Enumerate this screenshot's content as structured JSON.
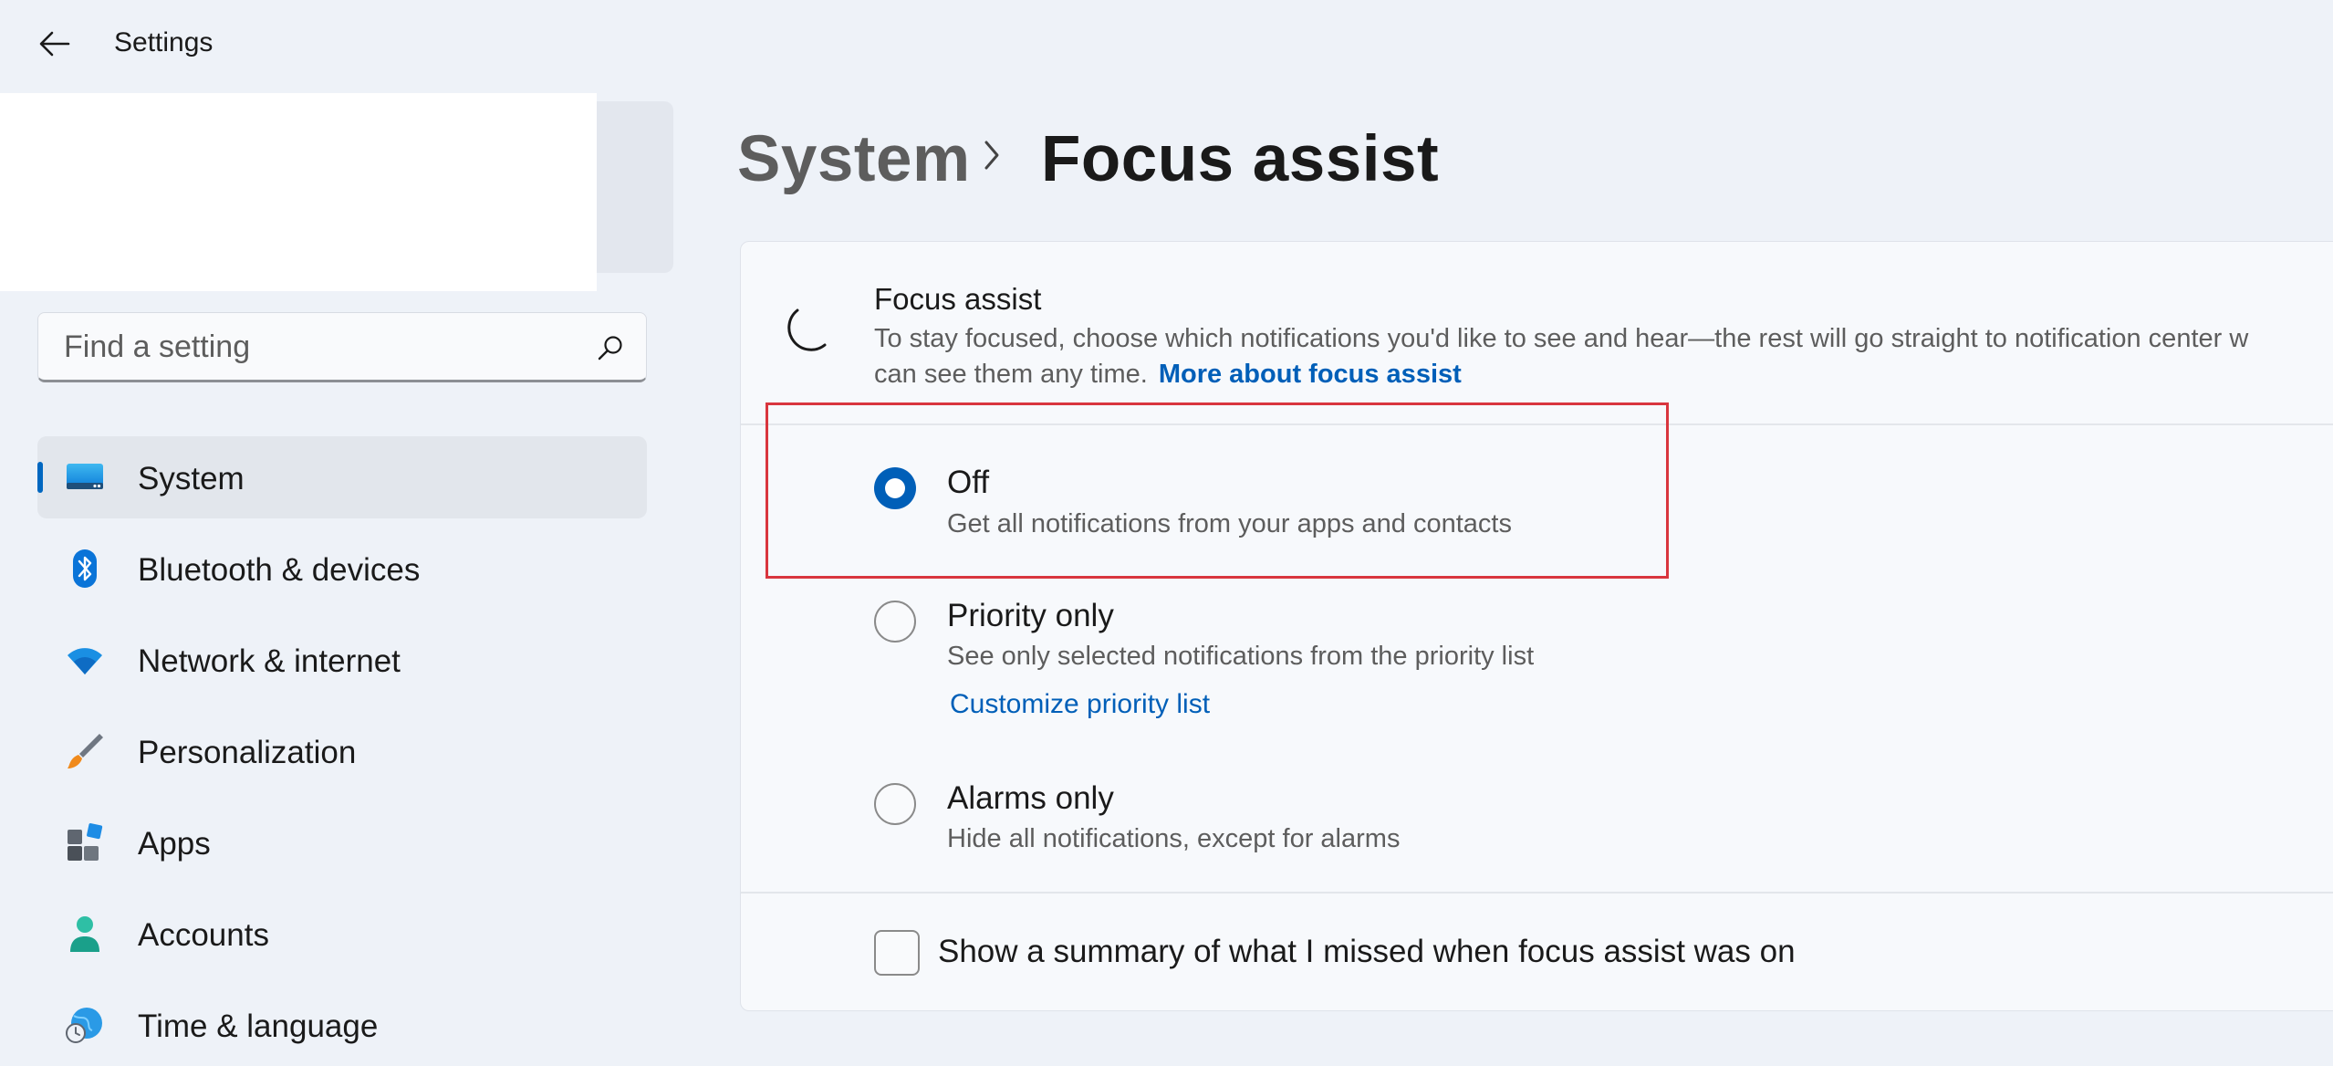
{
  "window": {
    "title": "Settings"
  },
  "search": {
    "placeholder": "Find a setting"
  },
  "sidebar": {
    "items": [
      {
        "label": "System",
        "icon": "system-display-icon",
        "selected": true
      },
      {
        "label": "Bluetooth & devices",
        "icon": "bluetooth-icon"
      },
      {
        "label": "Network & internet",
        "icon": "wifi-icon"
      },
      {
        "label": "Personalization",
        "icon": "paintbrush-icon"
      },
      {
        "label": "Apps",
        "icon": "apps-icon"
      },
      {
        "label": "Accounts",
        "icon": "person-icon"
      },
      {
        "label": "Time & language",
        "icon": "globe-clock-icon"
      }
    ]
  },
  "breadcrumb": {
    "parent": "System",
    "current": "Focus assist"
  },
  "focus_assist": {
    "title": "Focus assist",
    "description_line1": "To stay focused, choose which notifications you'd like to see and hear—the rest will go straight to notification center w",
    "description_line2": "can see them any time.",
    "link": "More about focus assist",
    "options": [
      {
        "title": "Off",
        "description": "Get all notifications from your apps and contacts",
        "checked": true
      },
      {
        "title": "Priority only",
        "description": "See only selected notifications from the priority list",
        "link": "Customize priority list",
        "checked": false
      },
      {
        "title": "Alarms only",
        "description": "Hide all notifications, except for alarms",
        "checked": false
      }
    ],
    "summary_checkbox": {
      "label": "Show a summary of what I missed when focus assist was on",
      "checked": false
    }
  },
  "colors": {
    "accent": "#005fb8",
    "highlight": "#d9363e",
    "selected_bg": "#e2e6ec"
  }
}
